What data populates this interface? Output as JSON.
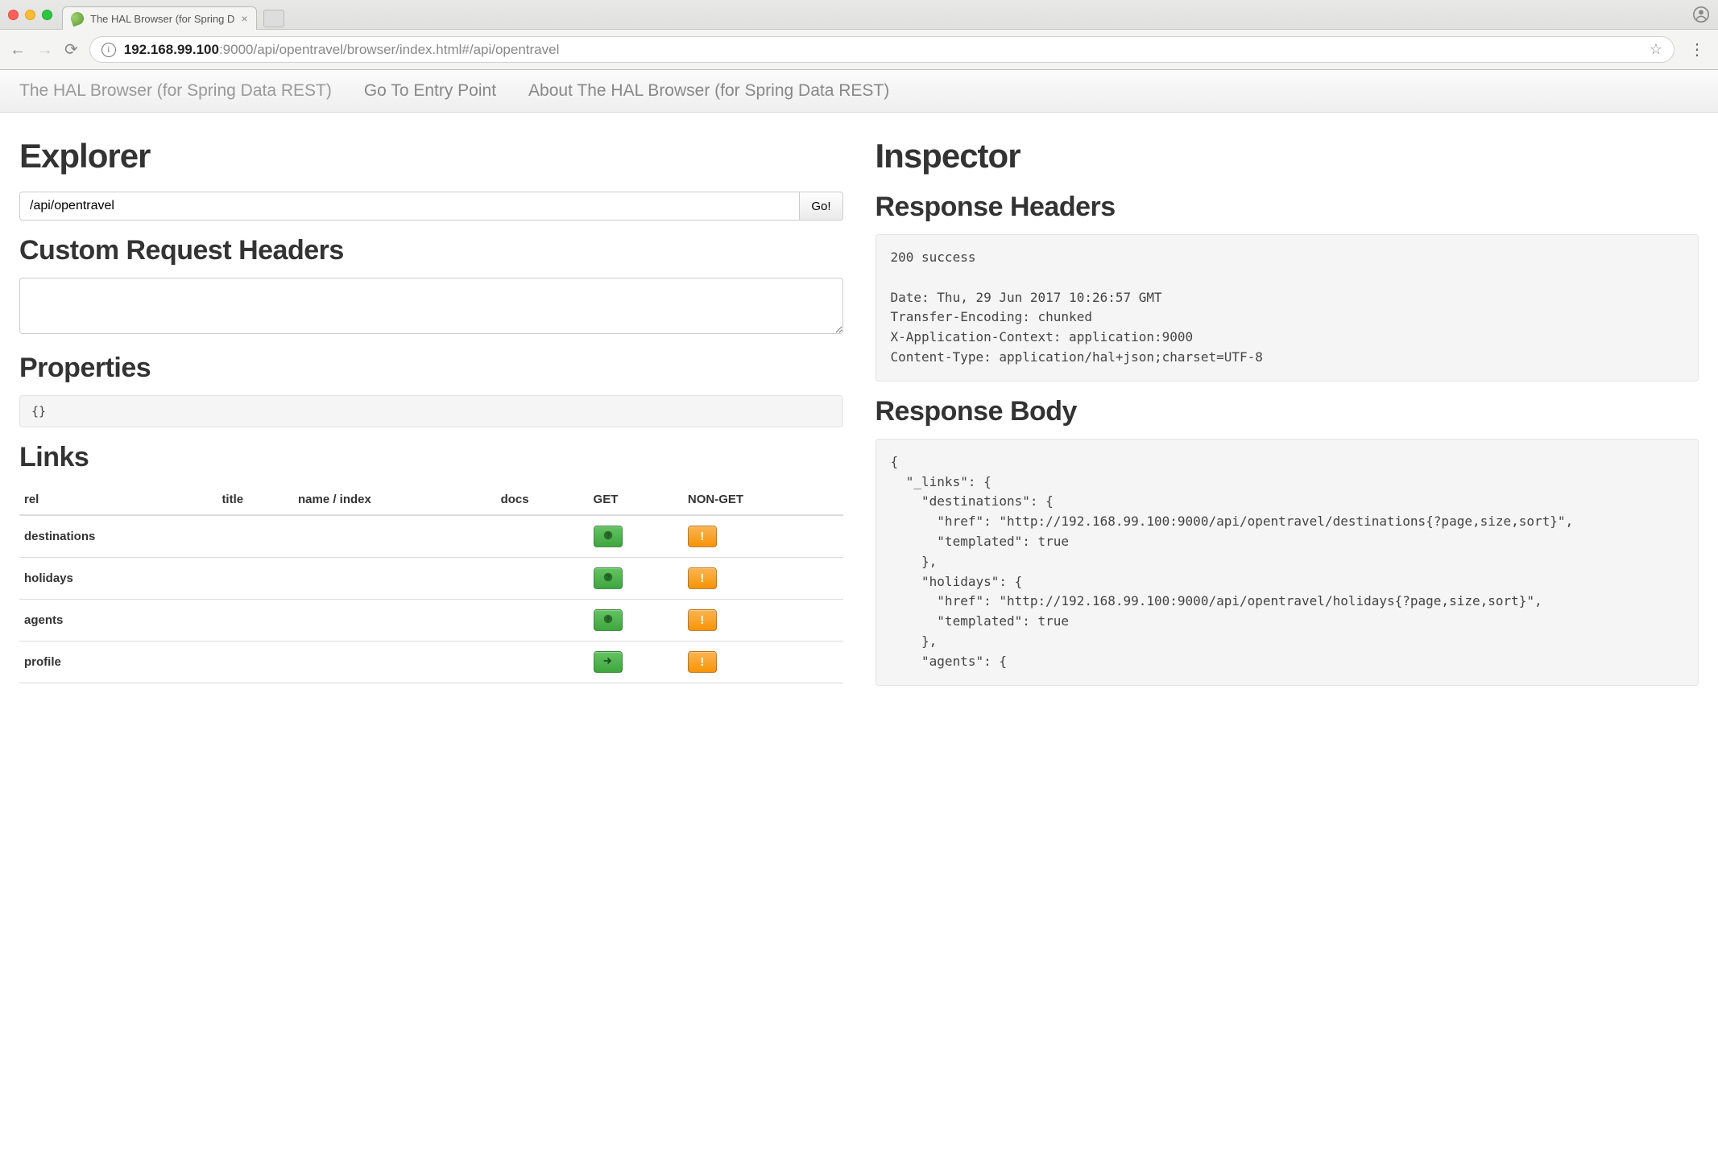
{
  "chrome": {
    "tab_title": "The HAL Browser (for Spring D",
    "url_host": "192.168.99.100",
    "url_rest": ":9000/api/opentravel/browser/index.html#/api/opentravel"
  },
  "nav": {
    "brand": "The HAL Browser (for Spring Data REST)",
    "entry": "Go To Entry Point",
    "about": "About The HAL Browser (for Spring Data REST)"
  },
  "explorer": {
    "title": "Explorer",
    "uri_value": "/api/opentravel",
    "go_label": "Go!",
    "headers_title": "Custom Request Headers",
    "headers_value": "",
    "properties_title": "Properties",
    "properties_value": "{}",
    "links_title": "Links",
    "link_cols": {
      "rel": "rel",
      "title": "title",
      "name": "name / index",
      "docs": "docs",
      "get": "GET",
      "nonget": "NON-GET"
    },
    "links": [
      {
        "rel": "destinations",
        "get_icon": "question"
      },
      {
        "rel": "holidays",
        "get_icon": "question"
      },
      {
        "rel": "agents",
        "get_icon": "question"
      },
      {
        "rel": "profile",
        "get_icon": "arrow"
      }
    ]
  },
  "inspector": {
    "title": "Inspector",
    "resp_headers_title": "Response Headers",
    "resp_headers": "200 success\n\nDate: Thu, 29 Jun 2017 10:26:57 GMT\nTransfer-Encoding: chunked\nX-Application-Context: application:9000\nContent-Type: application/hal+json;charset=UTF-8",
    "resp_body_title": "Response Body",
    "resp_body": "{\n  \"_links\": {\n    \"destinations\": {\n      \"href\": \"http://192.168.99.100:9000/api/opentravel/destinations{?page,size,sort}\",\n      \"templated\": true\n    },\n    \"holidays\": {\n      \"href\": \"http://192.168.99.100:9000/api/opentravel/holidays{?page,size,sort}\",\n      \"templated\": true\n    },\n    \"agents\": {"
  }
}
